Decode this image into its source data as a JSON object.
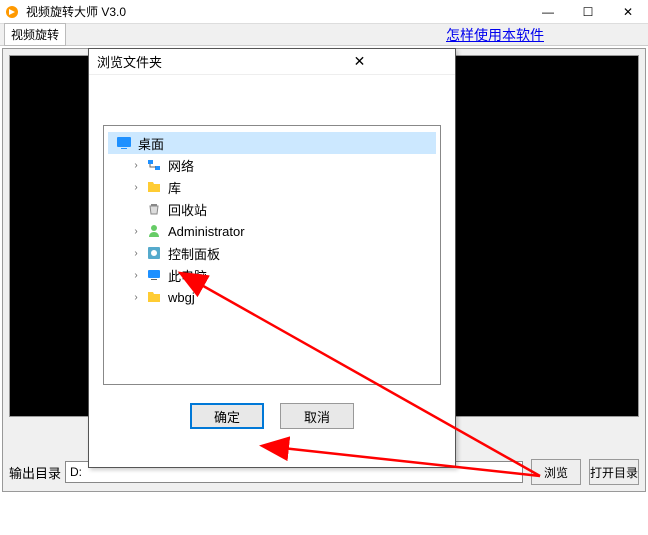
{
  "window": {
    "title": "视频旋转大师 V3.0"
  },
  "menu": {
    "rotate": "视频旋转",
    "help_link": "怎样使用本软件"
  },
  "output": {
    "label": "输出目录",
    "value": "D:",
    "browse": "浏览",
    "open_dir": "打开目录"
  },
  "dialog": {
    "title": "浏览文件夹",
    "ok": "确定",
    "cancel": "取消",
    "close": "✕",
    "tree": {
      "root": "桌面",
      "items": [
        {
          "label": "网络",
          "exp": "›"
        },
        {
          "label": "库",
          "exp": "›"
        },
        {
          "label": "回收站",
          "exp": ""
        },
        {
          "label": "Administrator",
          "exp": "›"
        },
        {
          "label": "控制面板",
          "exp": "›"
        },
        {
          "label": "此电脑",
          "exp": "›"
        },
        {
          "label": "wbgj",
          "exp": "›"
        }
      ]
    }
  }
}
